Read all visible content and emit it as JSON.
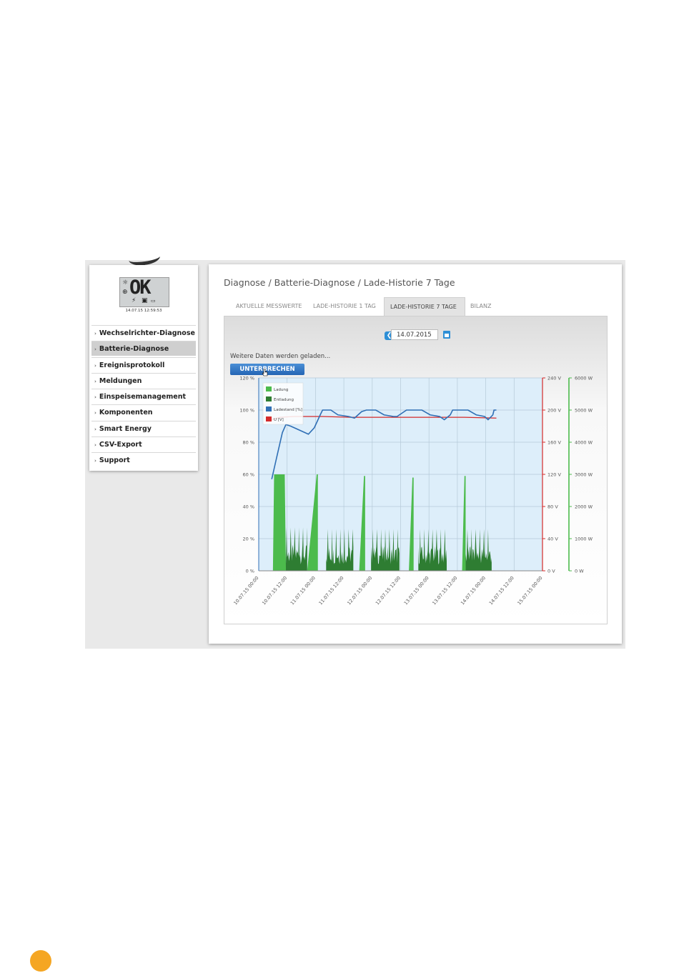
{
  "device": {
    "display": "OK",
    "timestamp": "14.07.15 12:59:53"
  },
  "sidebar": {
    "items": [
      {
        "label": "Wechselrichter-Diagnose",
        "active": false
      },
      {
        "label": "Batterie-Diagnose",
        "active": true
      },
      {
        "label": "Ereignisprotokoll",
        "active": false
      },
      {
        "label": "Meldungen",
        "active": false
      },
      {
        "label": "Einspeisemanagement",
        "active": false
      },
      {
        "label": "Komponenten",
        "active": false
      },
      {
        "label": "Smart Energy",
        "active": false
      },
      {
        "label": "CSV-Export",
        "active": false
      },
      {
        "label": "Support",
        "active": false
      }
    ]
  },
  "breadcrumb": "Diagnose / Batterie-Diagnose / Lade-Historie 7 Tage",
  "tabs": [
    {
      "label": "AKTUELLE MESSWERTE",
      "active": false
    },
    {
      "label": "LADE-HISTORIE 1 TAG",
      "active": false
    },
    {
      "label": "LADE-HISTORIE 7 TAGE",
      "active": true
    },
    {
      "label": "BILANZ",
      "active": false
    }
  ],
  "date_value": "14.07.2015",
  "loading_text": "Weitere Daten werden geladen...",
  "stop_button": "UNTERBRECHEN",
  "colors": {
    "accent": "#2e8fd6",
    "charge": "#4cbb4c",
    "discharge": "#2e7d32",
    "soc": "#2f6fb5",
    "voltage": "#d42a2a",
    "plot_bg": "#ddeefa"
  },
  "chart_data": {
    "type": "area",
    "x_unit": "date",
    "x_ticks": [
      "10.07.15 00:00",
      "10.07.15 12:00",
      "11.07.15 00:00",
      "11.07.15 12:00",
      "12.07.15 00:00",
      "12.07.15 12:00",
      "13.07.15 00:00",
      "13.07.15 12:00",
      "14.07.15 00:00",
      "14.07.15 12:00",
      "15.07.15 00:00"
    ],
    "left_axis": {
      "ticks": [
        "0 %",
        "20 %",
        "40 %",
        "60 %",
        "80 %",
        "100 %",
        "120 %"
      ],
      "range": [
        0,
        120
      ],
      "unit": "%"
    },
    "voltage_axis": {
      "ticks": [
        "0 V",
        "40 V",
        "80 V",
        "120 V",
        "160 V",
        "200 V",
        "240 V"
      ],
      "range": [
        0,
        240
      ],
      "unit": "V"
    },
    "power_axis": {
      "ticks": [
        "0 W",
        "1000 W",
        "2000 W",
        "3000 W",
        "4000 W",
        "5000 W",
        "6000 W"
      ],
      "range": [
        0,
        6000
      ],
      "unit": "W"
    },
    "legend": [
      "Ladung",
      "Entladung",
      "Ladestand [%]",
      "U [V]"
    ],
    "legend_placement": "top-left",
    "grid": true,
    "series": [
      {
        "name": "Ladestand [%]",
        "axis": "left",
        "points": [
          [
            11,
            57
          ],
          [
            15,
            70
          ],
          [
            20,
            86
          ],
          [
            23,
            91
          ],
          [
            27,
            90
          ],
          [
            36,
            87
          ],
          [
            42,
            85
          ],
          [
            47,
            89
          ],
          [
            52,
            97
          ],
          [
            54,
            100
          ],
          [
            61,
            100
          ],
          [
            67,
            97
          ],
          [
            76,
            96
          ],
          [
            81,
            95
          ],
          [
            87,
            99
          ],
          [
            91,
            100
          ],
          [
            99,
            100
          ],
          [
            106,
            97
          ],
          [
            114,
            96
          ],
          [
            117,
            96
          ],
          [
            123,
            99
          ],
          [
            125,
            100
          ],
          [
            138,
            100
          ],
          [
            145,
            97
          ],
          [
            153,
            96
          ],
          [
            157,
            94
          ],
          [
            162,
            97
          ],
          [
            164,
            100
          ],
          [
            177,
            100
          ],
          [
            184,
            97
          ],
          [
            191,
            96
          ],
          [
            194,
            94
          ],
          [
            198,
            97
          ],
          [
            199,
            100
          ],
          [
            201,
            100
          ]
        ]
      },
      {
        "name": "U [V]",
        "axis": "voltage",
        "points": [
          [
            11,
            188
          ],
          [
            18,
            191
          ],
          [
            30,
            192
          ],
          [
            54,
            192
          ],
          [
            78,
            191
          ],
          [
            102,
            191
          ],
          [
            126,
            191
          ],
          [
            150,
            191
          ],
          [
            174,
            191
          ],
          [
            201,
            190
          ]
        ]
      },
      {
        "name": "Ladung",
        "axis": "power",
        "segments": [
          {
            "shape": "block",
            "start": 12,
            "end": 23,
            "peak": 3000
          },
          {
            "shape": "ramp",
            "start": 41,
            "end": 50,
            "peak": 3000
          },
          {
            "shape": "ramp",
            "start": 85,
            "end": 90,
            "peak": 2950
          },
          {
            "shape": "ramp",
            "start": 127,
            "end": 131,
            "peak": 2900
          },
          {
            "shape": "ramp",
            "start": 172,
            "end": 175,
            "peak": 2950
          }
        ]
      },
      {
        "name": "Entladung",
        "axis": "power",
        "segments": [
          {
            "start": 22,
            "end": 41,
            "peak": 1350
          },
          {
            "start": 57,
            "end": 80,
            "peak": 1300
          },
          {
            "start": 95,
            "end": 119,
            "peak": 1300
          },
          {
            "start": 135,
            "end": 159,
            "peak": 1300
          },
          {
            "start": 175,
            "end": 197,
            "peak": 1300
          }
        ]
      }
    ]
  }
}
